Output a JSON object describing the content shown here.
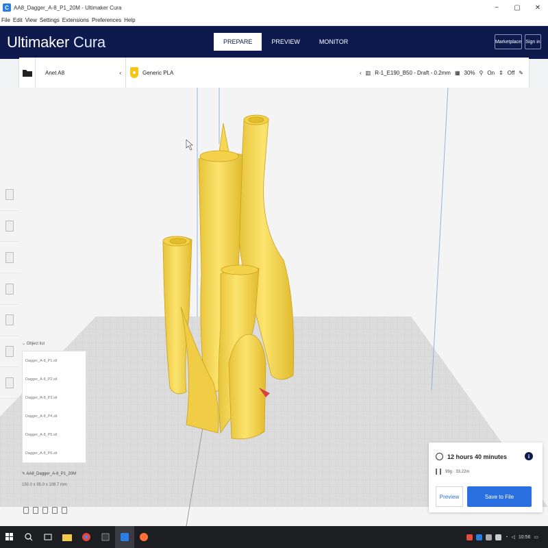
{
  "window": {
    "title": "AA8_Dagger_A-8_P1_20M - Ultimaker Cura",
    "minimize": "−",
    "maximize": "▢",
    "close": "✕"
  },
  "menu": [
    "File",
    "Edit",
    "View",
    "Settings",
    "Extensions",
    "Preferences",
    "Help"
  ],
  "header": {
    "brand_bold": "Ultimaker",
    "brand_thin": "Cura",
    "stages": [
      "PREPARE",
      "PREVIEW",
      "MONITOR"
    ],
    "marketplace": "Marketplace",
    "signin": "Sign in"
  },
  "toolbar": {
    "printer": "Anet A8",
    "material": "Generic PLA",
    "profile": "R-1_E190_B50 - Draft - 0.2mm",
    "infill": "30%",
    "support": "On",
    "adhesion": "Off"
  },
  "object_list": {
    "header": "Object list",
    "items": [
      "Dagger_A-8_P1.stl",
      "Dagger_A-8_P2.stl",
      "Dagger_A-8_P3.stl",
      "Dagger_A-8_P4.stl",
      "Dagger_A-8_P5.stl",
      "Dagger_A-8_P6.stl"
    ],
    "job_name": "AA8_Dagger_A-8_P1_20M",
    "dimensions": "150.0 x 95.0 x 108.7 mm"
  },
  "estimate": {
    "time": "12 hours 40 minutes",
    "material": "99g · 33.22m",
    "preview_label": "Preview",
    "save_label": "Save to File"
  },
  "taskbar": {
    "clock": "10:56"
  },
  "colors": {
    "header_bg": "#0e1a4e",
    "model_yellow": "#f7dc5c",
    "accent_blue": "#2a6fe0"
  }
}
